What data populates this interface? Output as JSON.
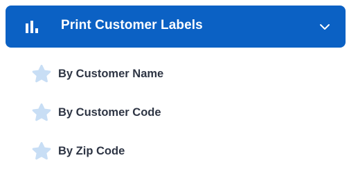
{
  "colors": {
    "header_background": "#0b61c4",
    "header_text": "#ffffff",
    "star_icon": "#c8def5",
    "item_text": "#2e3544"
  },
  "menu": {
    "header": {
      "title": "Print Customer Labels",
      "icon": "bar-chart-icon",
      "expand_icon": "chevron-down-icon",
      "expanded": true
    },
    "items": [
      {
        "label": "By Customer Name",
        "icon": "star-icon"
      },
      {
        "label": "By Customer Code",
        "icon": "star-icon"
      },
      {
        "label": "By Zip Code",
        "icon": "star-icon"
      }
    ]
  }
}
